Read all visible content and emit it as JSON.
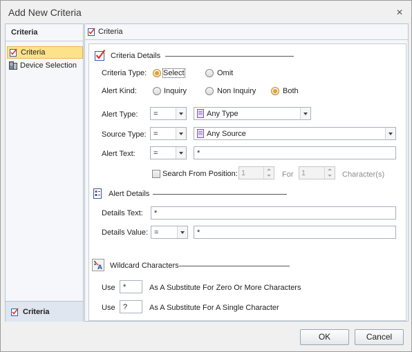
{
  "window": {
    "title": "Add New Criteria",
    "close_glyph": "✕"
  },
  "sidebar": {
    "header": "Criteria",
    "items": [
      {
        "label": "Criteria",
        "icon": "criteria-icon",
        "selected": true
      },
      {
        "label": "Device Selection",
        "icon": "device-icon",
        "selected": false
      }
    ],
    "bottom_label": "Criteria"
  },
  "main": {
    "header": "Criteria",
    "criteria_details": {
      "title": "Criteria Details",
      "criteria_type": {
        "label": "Criteria Type:",
        "options": [
          "Select",
          "Omit"
        ],
        "selected": "Select"
      },
      "alert_kind": {
        "label": "Alert Kind:",
        "options": [
          "Inquiry",
          "Non Inquiry",
          "Both"
        ],
        "selected": "Both"
      },
      "alert_type": {
        "label": "Alert Type:",
        "operator": "=",
        "value": "Any Type"
      },
      "source_type": {
        "label": "Source Type:",
        "operator": "=",
        "value": "Any Source"
      },
      "alert_text": {
        "label": "Alert Text:",
        "operator": "=",
        "value": "*"
      },
      "search_from": {
        "label": "Search From Position:",
        "from": "1",
        "for_label": "For",
        "for": "1",
        "suffix": "Character(s)"
      }
    },
    "alert_details": {
      "title": "Alert Details",
      "details_text": {
        "label": "Details Text:",
        "value": "*"
      },
      "details_value": {
        "label": "Details Value:",
        "operator": "=",
        "value": "*"
      }
    },
    "wildcards": {
      "title": "Wildcard Characters",
      "rows": [
        {
          "use": "Use",
          "char": "*",
          "desc": "As A Substitute For Zero Or More Characters"
        },
        {
          "use": "Use",
          "char": "?",
          "desc": "As A Substitute For A Single Character"
        }
      ]
    }
  },
  "buttons": {
    "ok": "OK",
    "cancel": "Cancel"
  },
  "colors": {
    "selected_bg": "#fce38a",
    "radio_dot": "#e8a21c",
    "icon_red": "#d9332b",
    "icon_blue": "#2f5aa8"
  }
}
